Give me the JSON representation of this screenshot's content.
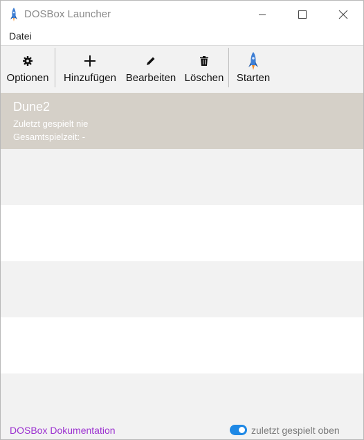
{
  "window": {
    "title": "DOSBox Launcher",
    "icon": "rocket-icon"
  },
  "menu": {
    "items": [
      "Datei"
    ]
  },
  "toolbar": {
    "options_label": "Optionen",
    "add_label": "Hinzufügen",
    "edit_label": "Bearbeiten",
    "delete_label": "Löschen",
    "start_label": "Starten",
    "icons": {
      "options": "gear-icon",
      "add": "plus-icon",
      "edit": "pencil-icon",
      "delete": "trash-icon",
      "start": "rocket-icon"
    }
  },
  "games": [
    {
      "name": "Dune2",
      "last_played": "Zuletzt gespielt nie",
      "total_time": "Gesamtspielzeit: -",
      "selected": true
    }
  ],
  "statusbar": {
    "doc_link": "DOSBox Dokumentation",
    "sort_toggle_label": "zuletzt gespielt oben",
    "sort_toggle_on": true
  },
  "colors": {
    "selected_row": "#d5d0c8",
    "link": "#9b30d0",
    "toggle_on": "#1e88e5"
  }
}
